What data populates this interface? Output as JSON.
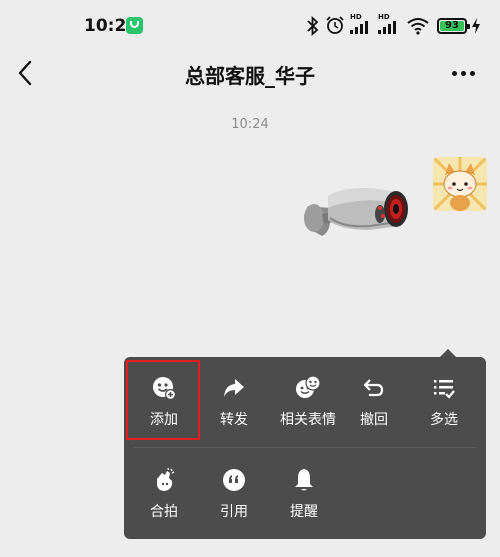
{
  "status_bar": {
    "time": "10:25",
    "app_icon": "green-chat-badge",
    "network_label_1": "HD",
    "network_label_2": "HD",
    "battery_level": "93",
    "icons": [
      "bluetooth-icon",
      "alarm-icon",
      "signal-icon",
      "signal-icon",
      "wifi-icon",
      "battery-icon",
      "charging-icon"
    ]
  },
  "header": {
    "back_icon": "chevron-left-icon",
    "title": "总部客服_华子",
    "more_icon": "ellipsis-icon"
  },
  "chat": {
    "timestamp": "10:24",
    "message_sticker": "security-camera-sticker",
    "avatar": "cartoon-fox-avatar"
  },
  "context_menu": {
    "row1": [
      {
        "label": "添加",
        "icon": "emoji-add-icon"
      },
      {
        "label": "转发",
        "icon": "forward-icon"
      },
      {
        "label": "相关表情",
        "icon": "related-emoji-icon"
      },
      {
        "label": "撤回",
        "icon": "undo-icon"
      },
      {
        "label": "多选",
        "icon": "multi-select-icon"
      }
    ],
    "row2": [
      {
        "label": "合拍",
        "icon": "pat-icon"
      },
      {
        "label": "引用",
        "icon": "quote-icon"
      },
      {
        "label": "提醒",
        "icon": "bell-icon"
      }
    ]
  },
  "colors": {
    "background": "#ededed",
    "menu_background": "#4c4c4c",
    "highlight": "#e02020",
    "battery_fill": "#35c25a"
  }
}
